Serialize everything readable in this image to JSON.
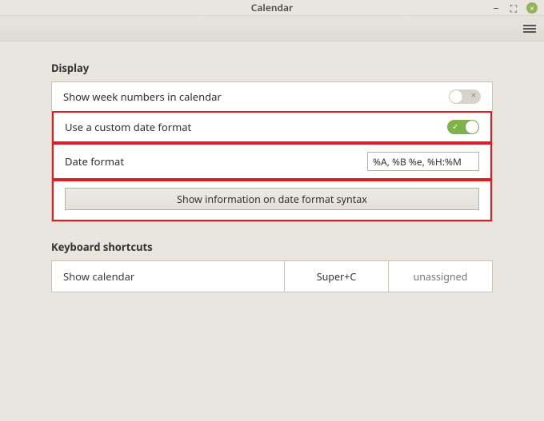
{
  "window": {
    "title": "Calendar"
  },
  "sections": {
    "display_title": "Display",
    "shortcuts_title": "Keyboard shortcuts"
  },
  "display": {
    "show_week_numbers_label": "Show week numbers in calendar",
    "show_week_numbers_on": false,
    "custom_format_label": "Use a custom date format",
    "custom_format_on": true,
    "date_format_label": "Date format",
    "date_format_value": "%A, %B %e, %H:%M",
    "syntax_button_label": "Show information on date format syntax"
  },
  "shortcuts": {
    "rows": [
      {
        "label": "Show calendar",
        "primary": "Super+C",
        "secondary": "unassigned"
      }
    ]
  }
}
